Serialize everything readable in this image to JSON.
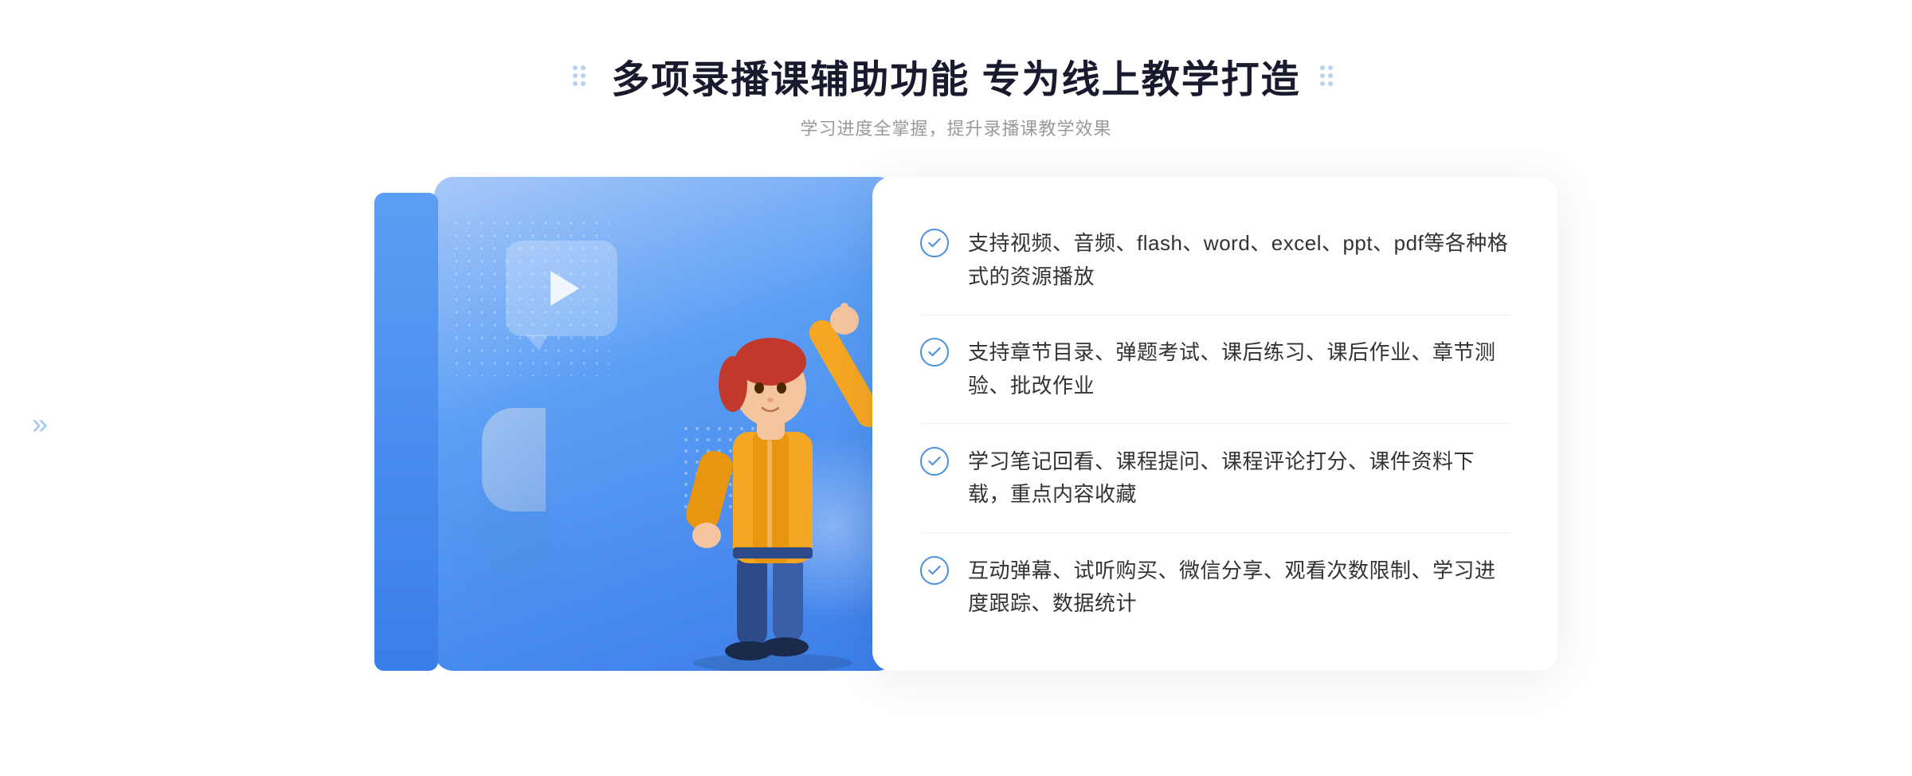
{
  "page": {
    "background_color": "#ffffff"
  },
  "header": {
    "title": "多项录播课辅助功能 专为线上教学打造",
    "subtitle": "学习进度全掌握，提升录播课教学效果",
    "left_dots_label": "decorative-dots-left",
    "right_dots_label": "decorative-dots-right"
  },
  "features": [
    {
      "id": 1,
      "text": "支持视频、音频、flash、word、excel、ppt、pdf等各种格式的资源播放"
    },
    {
      "id": 2,
      "text": "支持章节目录、弹题考试、课后练习、课后作业、章节测验、批改作业"
    },
    {
      "id": 3,
      "text": "学习笔记回看、课程提问、课程评论打分、课件资料下载，重点内容收藏"
    },
    {
      "id": 4,
      "text": "互动弹幕、试听购买、微信分享、观看次数限制、学习进度跟踪、数据统计"
    }
  ],
  "illustration": {
    "play_button_label": "play-button",
    "arrow_left": "«"
  },
  "colors": {
    "blue_primary": "#4a90e2",
    "blue_gradient_start": "#a8c8f8",
    "blue_gradient_end": "#3b7de8",
    "text_dark": "#1a1a2e",
    "text_gray": "#999999",
    "text_body": "#333333"
  }
}
